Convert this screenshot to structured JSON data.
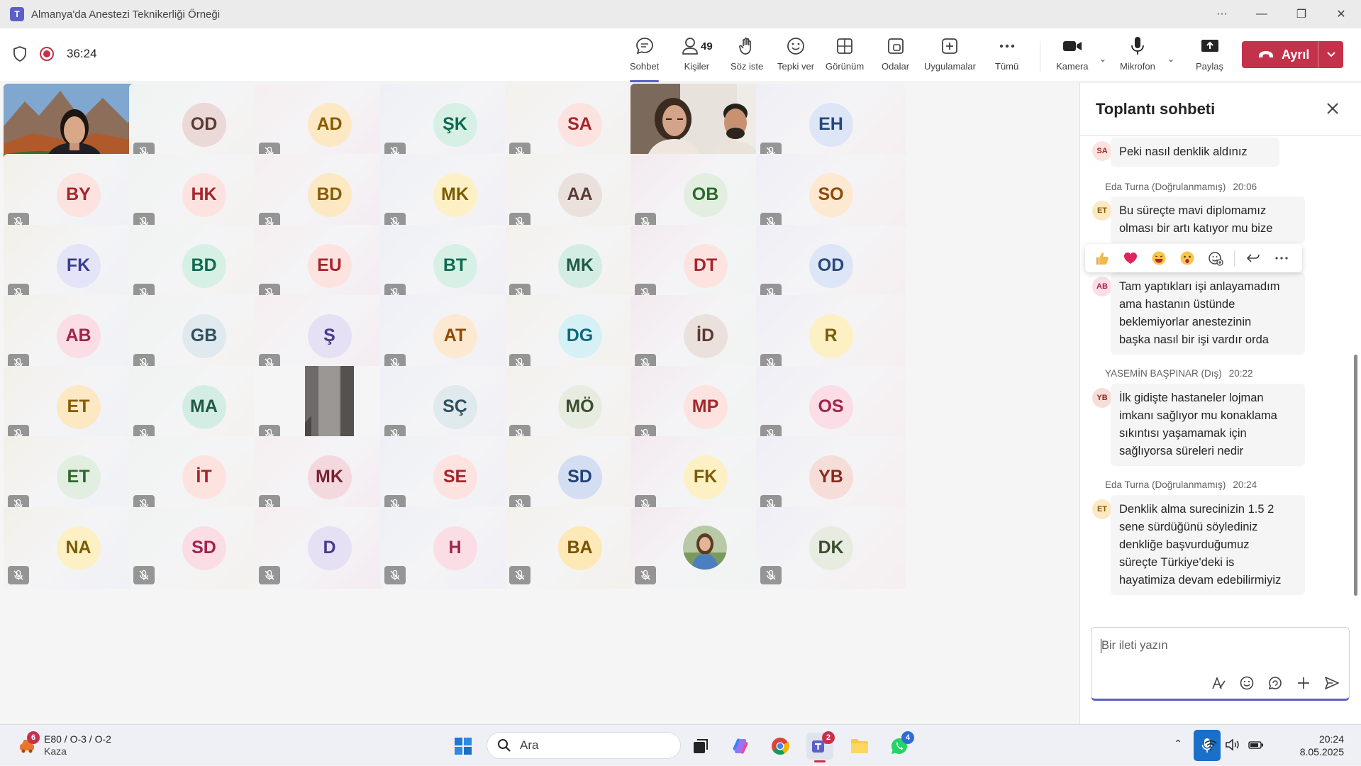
{
  "window": {
    "title": "Almanya'da Anestezi Teknikerliği Örneği",
    "controls": [
      "more",
      "minimize",
      "maximize",
      "close"
    ]
  },
  "meeting": {
    "timer": "36:24",
    "toolbar": {
      "chat": "Sohbet",
      "people": "Kişiler",
      "people_count": "49",
      "raise": "Söz iste",
      "react": "Tepki ver",
      "view": "Görünüm",
      "rooms": "Odalar",
      "apps": "Uygulamalar",
      "more": "Tümü",
      "camera": "Kamera",
      "mic": "Mikrofon",
      "share": "Paylaş",
      "leave": "Ayrıl"
    }
  },
  "participants": [
    {
      "initials": "",
      "type": "video-woman"
    },
    {
      "initials": "OD",
      "bg": "#ead9d6",
      "fg": "#5c3b34"
    },
    {
      "initials": "AD",
      "bg": "#fce9c4",
      "fg": "#8a5a00"
    },
    {
      "initials": "ŞK",
      "bg": "#d6f0e6",
      "fg": "#0e6b4f"
    },
    {
      "initials": "SA",
      "bg": "#fde3df",
      "fg": "#a4262c"
    },
    {
      "initials": "",
      "type": "video-couple"
    },
    {
      "initials": "EH",
      "bg": "#dde6f6",
      "fg": "#28487e"
    },
    {
      "initials": "BY",
      "bg": "#fde3df",
      "fg": "#a4262c"
    },
    {
      "initials": "HK",
      "bg": "#fde3df",
      "fg": "#a4262c"
    },
    {
      "initials": "BD",
      "bg": "#fce9c4",
      "fg": "#8a5a00"
    },
    {
      "initials": "MK",
      "bg": "#fdf0c4",
      "fg": "#7a5c00"
    },
    {
      "initials": "AA",
      "bg": "#ebe1dc",
      "fg": "#5c3b34"
    },
    {
      "initials": "OB",
      "bg": "#e2efe0",
      "fg": "#2d6a2b"
    },
    {
      "initials": "SO",
      "bg": "#fde9d2",
      "fg": "#8e4a00"
    },
    {
      "initials": "FK",
      "bg": "#e3e4f7",
      "fg": "#393d8f"
    },
    {
      "initials": "BD",
      "bg": "#d6f0e6",
      "fg": "#0e6b4f"
    },
    {
      "initials": "EU",
      "bg": "#fde3df",
      "fg": "#a4262c"
    },
    {
      "initials": "BT",
      "bg": "#d6f0e6",
      "fg": "#0e6b4f"
    },
    {
      "initials": "MK",
      "bg": "#d4ede4",
      "fg": "#1f5a48"
    },
    {
      "initials": "DT",
      "bg": "#fde3df",
      "fg": "#a4262c"
    },
    {
      "initials": "OD",
      "bg": "#dde6f6",
      "fg": "#28487e"
    },
    {
      "initials": "AB",
      "bg": "#fbdde6",
      "fg": "#a0244d"
    },
    {
      "initials": "GB",
      "bg": "#dfe9ee",
      "fg": "#2f4f5e"
    },
    {
      "initials": "Ş",
      "bg": "#e6e0f5",
      "fg": "#4b3a8a"
    },
    {
      "initials": "AT",
      "bg": "#fde9d2",
      "fg": "#8e4a00"
    },
    {
      "initials": "DG",
      "bg": "#d6f1f5",
      "fg": "#0b6a7a"
    },
    {
      "initials": "İD",
      "bg": "#ebe1dc",
      "fg": "#5c3b34"
    },
    {
      "initials": "R",
      "bg": "#fdf0c4",
      "fg": "#7a5c00"
    },
    {
      "initials": "ET",
      "bg": "#fce9c4",
      "fg": "#8a5a00"
    },
    {
      "initials": "MA",
      "bg": "#d4ede4",
      "fg": "#1f5a48"
    },
    {
      "initials": "",
      "type": "video-door"
    },
    {
      "initials": "SÇ",
      "bg": "#dfe9ee",
      "fg": "#2f4f5e"
    },
    {
      "initials": "MÖ",
      "bg": "#e7ece1",
      "fg": "#3d4d2e"
    },
    {
      "initials": "MP",
      "bg": "#fde3df",
      "fg": "#a4262c"
    },
    {
      "initials": "OS",
      "bg": "#fbdde6",
      "fg": "#a0244d"
    },
    {
      "initials": "ET",
      "bg": "#e2efe0",
      "fg": "#2d6a2b"
    },
    {
      "initials": "İT",
      "bg": "#fde3df",
      "fg": "#a4262c"
    },
    {
      "initials": "MK",
      "bg": "#f3d9de",
      "fg": "#7a2035"
    },
    {
      "initials": "SE",
      "bg": "#fde3df",
      "fg": "#a4262c"
    },
    {
      "initials": "SD",
      "bg": "#d4def2",
      "fg": "#21427a"
    },
    {
      "initials": "FK",
      "bg": "#fdf0c4",
      "fg": "#7a5c00"
    },
    {
      "initials": "YB",
      "bg": "#f6ddd8",
      "fg": "#8a2b20"
    },
    {
      "initials": "NA",
      "bg": "#fdf0c4",
      "fg": "#7a5c00"
    },
    {
      "initials": "SD",
      "bg": "#fbdde6",
      "fg": "#a0244d"
    },
    {
      "initials": "D",
      "bg": "#e6e0f5",
      "fg": "#4b3a8a"
    },
    {
      "initials": "H",
      "bg": "#fbdde6",
      "fg": "#a0244d"
    },
    {
      "initials": "BA",
      "bg": "#fde9b8",
      "fg": "#7a5200"
    },
    {
      "initials": "",
      "type": "photo-avatar"
    },
    {
      "initials": "DK",
      "bg": "#e7ece1",
      "fg": "#3d4d2e"
    }
  ],
  "chat": {
    "title": "Toplantı sohbeti",
    "messages": [
      {
        "avatar": "SA",
        "avatar_bg": "#fde3df",
        "avatar_fg": "#a4262c",
        "author": "",
        "time": "",
        "text": [
          "Peki nasıl denklik aldınız"
        ]
      },
      {
        "avatar": "ET",
        "avatar_bg": "#fce9c4",
        "avatar_fg": "#8a5a00",
        "author": "Eda Turna (Doğrulanmamış)",
        "time": "20:06",
        "text": [
          "Bu süreçte mavi diplomamız",
          "olması bir artı katıyor mu bize"
        ]
      },
      {
        "avatar": "AB",
        "avatar_bg": "#fbdde6",
        "avatar_fg": "#a0244d",
        "author": "",
        "time": "",
        "text": [
          "Tam yaptıkları işi anlayamadım",
          "ama hastanın üstünde",
          "beklemiyorlar anestezinin",
          "başka nasıl bir işi vardır orda"
        ]
      },
      {
        "avatar": "YB",
        "avatar_bg": "#f6ddd8",
        "avatar_fg": "#8a2b20",
        "author": "YASEMİN BAŞPINAR (Dış)",
        "time": "20:22",
        "text": [
          "İlk gidişte hastaneler lojman",
          "imkanı sağlıyor mu konaklama",
          "sıkıntısı yaşamamak için",
          "sağlıyorsa süreleri nedir"
        ]
      },
      {
        "avatar": "ET",
        "avatar_bg": "#fce9c4",
        "avatar_fg": "#8a5a00",
        "author": "Eda Turna (Doğrulanmamış)",
        "time": "20:24",
        "text": [
          "Denklik alma surecinizin 1.5 2",
          "sene sürdüğünü söylediniz",
          "denkliğe başvurduğumuz",
          "süreçte Türkiye'deki is",
          "hayatimiza devam edebilirmiyiz"
        ]
      }
    ],
    "reactions": [
      "thumbs-up",
      "heart",
      "laugh",
      "surprised",
      "add-reaction",
      "reply",
      "more"
    ],
    "composer_placeholder": "Bir ileti yazın"
  },
  "taskbar": {
    "weather_badge": "6",
    "weather_line1": "E80 / O-3 / O-2",
    "weather_line2": "Kaza",
    "search_placeholder": "Ara",
    "teams_badge": "2",
    "whatsapp_badge": "4",
    "time": "20:24",
    "date": "8.05.2025"
  }
}
